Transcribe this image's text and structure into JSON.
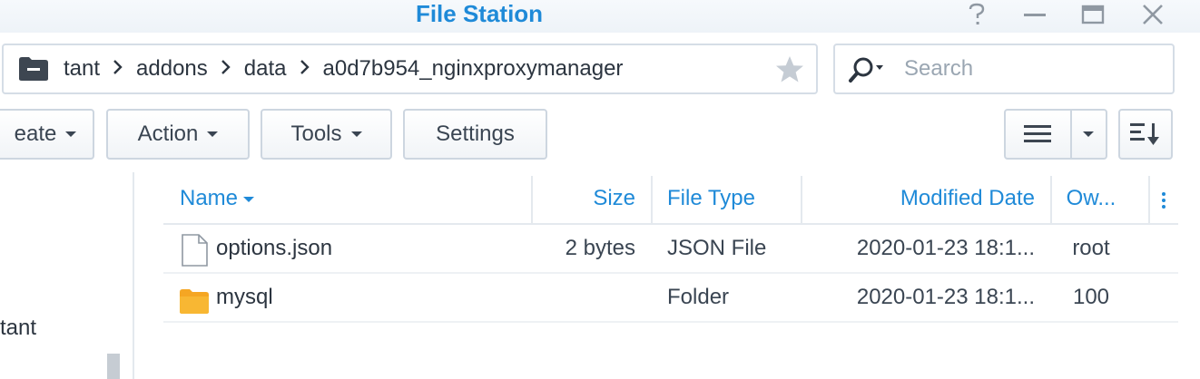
{
  "window": {
    "title": "File Station",
    "controls": {
      "help": "help-icon",
      "minimize": "minimize-icon",
      "maximize": "maximize-icon",
      "close": "close-icon"
    }
  },
  "pathbar": {
    "icon": "folder-icon",
    "crumbs": [
      "tant",
      "addons",
      "data",
      "a0d7b954_nginxproxymanager"
    ],
    "favorite_icon": "star-icon"
  },
  "search": {
    "placeholder": "Search",
    "value": ""
  },
  "toolbar": {
    "create_label": "eate",
    "action_label": "Action",
    "tools_label": "Tools",
    "settings_label": "Settings",
    "view_icon": "list-view-icon",
    "sort_icon": "sort-icon"
  },
  "left_pane": {
    "items": [
      "tant"
    ]
  },
  "filelist": {
    "columns": {
      "name": "Name",
      "size": "Size",
      "file_type": "File Type",
      "modified": "Modified Date",
      "owner": "Ow..."
    },
    "rows": [
      {
        "icon": "file-icon",
        "name": "options.json",
        "size": "2 bytes",
        "file_type": "JSON File",
        "modified": "2020-01-23 18:1...",
        "owner": "root"
      },
      {
        "icon": "folder-icon",
        "name": "mysql",
        "size": "",
        "file_type": "Folder",
        "modified": "2020-01-23 18:1...",
        "owner": "100"
      }
    ]
  },
  "colors": {
    "accent": "#1f8ad8",
    "folder": "#f5a623"
  }
}
